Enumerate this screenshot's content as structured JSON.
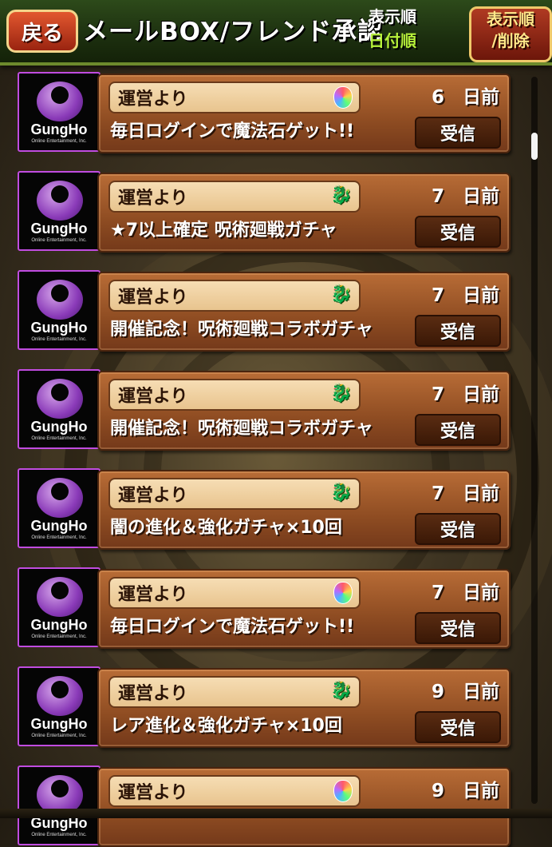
{
  "header": {
    "back_label": "戻る",
    "title": "メールBOX/フレンド承認",
    "sort_label_line1": "表示順",
    "sort_label_line2": "日付順",
    "sort_button_line1": "表示順",
    "sort_button_line2": "/削除"
  },
  "mails": [
    {
      "logo_text": "GungHo",
      "logo_sub": "Online Entertainment, Inc.",
      "sender": "運営より",
      "icon": "magic-stone-icon",
      "days": "6　日前",
      "subject": "毎日ログインで魔法石ゲット!!",
      "button": "受信"
    },
    {
      "logo_text": "GungHo",
      "logo_sub": "Online Entertainment, Inc.",
      "sender": "運営より",
      "icon": "dragon-icon",
      "days": "7　日前",
      "subject": "★7以上確定 呪術廻戦ガチャ",
      "button": "受信"
    },
    {
      "logo_text": "GungHo",
      "logo_sub": "Online Entertainment, Inc.",
      "sender": "運営より",
      "icon": "dragon-icon",
      "days": "7　日前",
      "subject": "開催記念！呪術廻戦コラボガチャ",
      "button": "受信"
    },
    {
      "logo_text": "GungHo",
      "logo_sub": "Online Entertainment, Inc.",
      "sender": "運営より",
      "icon": "dragon-icon",
      "days": "7　日前",
      "subject": "開催記念！呪術廻戦コラボガチャ",
      "button": "受信"
    },
    {
      "logo_text": "GungHo",
      "logo_sub": "Online Entertainment, Inc.",
      "sender": "運営より",
      "icon": "dragon-icon",
      "days": "7　日前",
      "subject": "闇の進化＆強化ガチャ×10回",
      "button": "受信"
    },
    {
      "logo_text": "GungHo",
      "logo_sub": "Online Entertainment, Inc.",
      "sender": "運営より",
      "icon": "magic-stone-icon",
      "days": "7　日前",
      "subject": "毎日ログインで魔法石ゲット!!",
      "button": "受信"
    },
    {
      "logo_text": "GungHo",
      "logo_sub": "Online Entertainment, Inc.",
      "sender": "運営より",
      "icon": "dragon-icon",
      "days": "9　日前",
      "subject": "レア進化＆強化ガチャ×10回",
      "button": "受信"
    },
    {
      "logo_text": "GungHo",
      "logo_sub": "Online Entertainment, Inc.",
      "sender": "運営より",
      "icon": "magic-stone-icon",
      "days": "9　日前",
      "subject": "",
      "button": ""
    }
  ],
  "scroll_position": 0.08
}
